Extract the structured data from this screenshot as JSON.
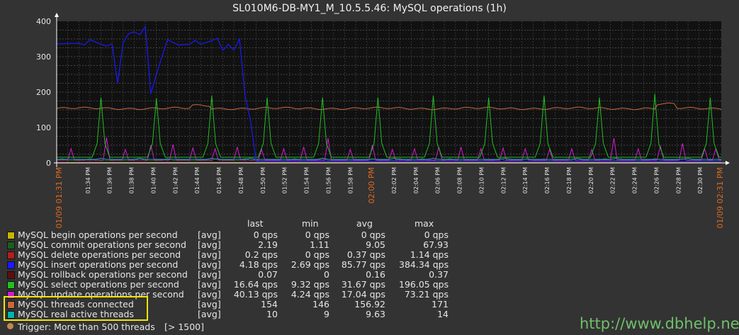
{
  "chart_data": {
    "type": "line",
    "title": "SL010M6-DB-MY1_M_10.5.5.46: MySQL operations (1h)",
    "ylim": [
      0,
      400
    ],
    "yticks": [
      0,
      100,
      200,
      300,
      400
    ],
    "xticks": [
      "01/09 01:31 PM",
      "01:34 PM",
      "01:36 PM",
      "01:38 PM",
      "01:40 PM",
      "01:42 PM",
      "01:44 PM",
      "01:46 PM",
      "01:48 PM",
      "01:50 PM",
      "01:52 PM",
      "01:54 PM",
      "01:56 PM",
      "01:58 PM",
      "02:00 PM",
      "02:02 PM",
      "02:04 PM",
      "02:06 PM",
      "02:08 PM",
      "02:10 PM",
      "02:12 PM",
      "02:14 PM",
      "02:16 PM",
      "02:18 PM",
      "02:20 PM",
      "02:22 PM",
      "02:24 PM",
      "02:26 PM",
      "02:28 PM",
      "02:30 PM",
      "01/09 02:31 PM"
    ],
    "x_start": "01/09 01:31 PM",
    "x_end": "01/09 02:31 PM",
    "grid": true,
    "colors": {
      "begin": "#c8b400",
      "commit": "#1b5e20",
      "delete": "#b71c1c",
      "insert": "#1a1aff",
      "rollback": "#5d0f0f",
      "select": "#21c021",
      "update": "#d21dd2",
      "threads_connected": "#c8693a",
      "real_active": "#00b0b0",
      "trigger": "#c08a4a",
      "time_highlight": "#e06a20"
    },
    "series": [
      {
        "key": "insert",
        "name": "MySQL insert operations per second",
        "x": [
          0,
          1,
          2,
          2.5,
          3,
          4,
          4.5,
          5,
          5.5,
          6,
          6.5,
          7,
          7.5,
          8,
          8.5,
          9,
          10,
          11,
          12,
          12.5,
          13,
          14,
          14.5,
          15,
          15.5,
          16,
          16.5,
          17,
          17.5,
          18,
          60
        ],
        "values": [
          336,
          337,
          338,
          333,
          348,
          335,
          330,
          336,
          225,
          340,
          365,
          370,
          362,
          385,
          195,
          250,
          348,
          333,
          335,
          346,
          335,
          345,
          352,
          318,
          335,
          318,
          350,
          190,
          120,
          5,
          4
        ]
      },
      {
        "key": "select",
        "name": "MySQL select operations per second",
        "peak_minutes": [
          4,
          9,
          14,
          19,
          24,
          29,
          34,
          39,
          44,
          49,
          54,
          59
        ],
        "peak_values": [
          185,
          183,
          190,
          185,
          185,
          185,
          190,
          185,
          190,
          185,
          195,
          185
        ],
        "baseline": 16
      },
      {
        "key": "update",
        "name": "MySQL update operations per second",
        "peak_minutes": [
          1.3,
          4.5,
          6.2,
          8.5,
          10.5,
          12.3,
          14.3,
          16.3,
          18.5,
          20.5,
          22.3,
          24.5,
          26.5,
          28.5,
          30.3,
          32.3,
          34.5,
          36.5,
          38.3,
          40.3,
          42.3,
          44.5,
          46.5,
          48.3,
          50.3,
          52.5,
          54.5,
          56.5,
          58.5,
          59.5
        ],
        "peak_values": [
          40,
          72,
          38,
          50,
          52,
          42,
          40,
          45,
          38,
          40,
          45,
          70,
          38,
          50,
          38,
          40,
          45,
          45,
          40,
          42,
          40,
          38,
          40,
          38,
          70,
          40,
          48,
          55,
          40,
          40
        ],
        "baseline": 8
      },
      {
        "key": "threads_connected",
        "name": "MySQL threads connected",
        "approx": 154,
        "range": [
          146,
          171
        ]
      },
      {
        "key": "real_active",
        "name": "MySQL real active threads",
        "approx": 10
      }
    ]
  },
  "legend": {
    "headers": {
      "last": "last",
      "min": "min",
      "avg": "avg",
      "max": "max"
    },
    "rows": [
      {
        "color": "#c8b400",
        "name": "MySQL begin operations per second",
        "fn": "[avg]",
        "last": "0 qps",
        "min": "0 qps",
        "avg": "0 qps",
        "max": "0 qps"
      },
      {
        "color": "#1b5e20",
        "name": "MySQL commit operations per second",
        "fn": "[avg]",
        "last": "2.19",
        "min": "1.11",
        "avg": "9.05",
        "max": "67.93"
      },
      {
        "color": "#b71c1c",
        "name": "MySQL delete operations per second",
        "fn": "[avg]",
        "last": "0.2 qps",
        "min": "0 qps",
        "avg": "0.37 qps",
        "max": "1.14 qps"
      },
      {
        "color": "#1a1aff",
        "name": "MySQL insert operations per second",
        "fn": "[avg]",
        "last": "4.18 qps",
        "min": "2.69 qps",
        "avg": "85.77 qps",
        "max": "384.34 qps"
      },
      {
        "color": "#5d0f0f",
        "name": "MySQL rollback operations per second",
        "fn": "[avg]",
        "last": "0.07",
        "min": "0",
        "avg": "0.16",
        "max": "0.37"
      },
      {
        "color": "#21c021",
        "name": "MySQL select operations per second",
        "fn": "[avg]",
        "last": "16.64 qps",
        "min": "9.32 qps",
        "avg": "31.67 qps",
        "max": "196.05 qps"
      },
      {
        "color": "#d21dd2",
        "name": "MySQL update operations per second",
        "fn": "[avg]",
        "last": "40.13 qps",
        "min": "4.24 qps",
        "avg": "17.04 qps",
        "max": "73.21 qps"
      },
      {
        "color": "#c8693a",
        "name": "MySQL threads connected",
        "fn": "[avg]",
        "last": "154",
        "min": "146",
        "avg": "156.92",
        "max": "171"
      },
      {
        "color": "#00b0b0",
        "name": "MySQL real active threads",
        "fn": "[avg]",
        "last": "10",
        "min": "9",
        "avg": "9.63",
        "max": "14"
      }
    ],
    "trigger": {
      "label": "Trigger: More than 500 threads",
      "value": "[> 1500]",
      "color": "#c08a4a"
    }
  },
  "watermark": "http://www.dbhelp.net"
}
